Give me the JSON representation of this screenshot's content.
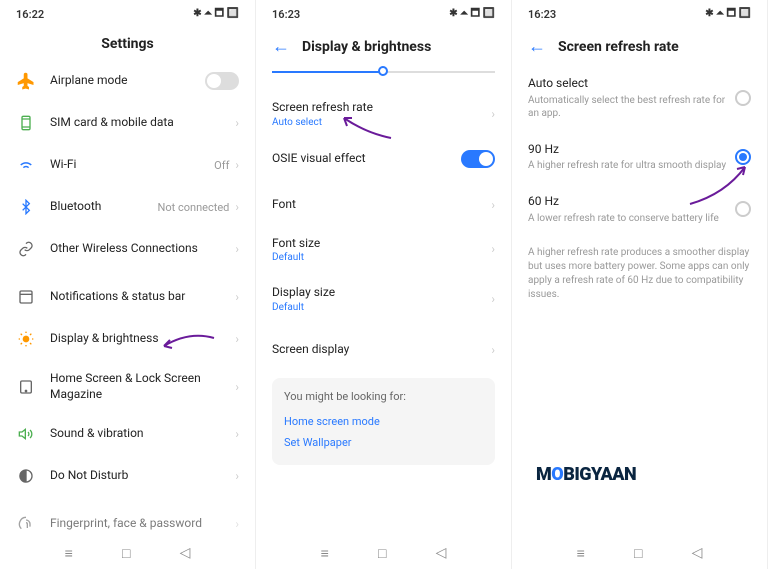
{
  "status": {
    "time1": "16:22",
    "time2": "16:23",
    "time3": "16:23",
    "icons": "✱ ⏶ 🗖 🔲"
  },
  "s1": {
    "title": "Settings",
    "items": {
      "airplane": "Airplane mode",
      "sim": "SIM card & mobile data",
      "wifi": "Wi-Fi",
      "wifi_val": "Off",
      "bt": "Bluetooth",
      "bt_val": "Not connected",
      "owc": "Other Wireless Connections",
      "notif": "Notifications & status bar",
      "display": "Display & brightness",
      "home": "Home Screen & Lock Screen Magazine",
      "sound": "Sound & vibration",
      "dnd": "Do Not Disturb",
      "finger": "Fingerprint, face & password"
    }
  },
  "s2": {
    "title": "Display & brightness",
    "refresh": "Screen refresh rate",
    "refresh_sub": "Auto select",
    "osie": "OSIE visual effect",
    "font": "Font",
    "fontsize": "Font size",
    "fontsize_sub": "Default",
    "dispsize": "Display size",
    "dispsize_sub": "Default",
    "screendisp": "Screen display",
    "suggest_head": "You might be looking for:",
    "suggest1": "Home screen mode",
    "suggest2": "Set Wallpaper"
  },
  "s3": {
    "title": "Screen refresh rate",
    "auto": "Auto select",
    "auto_desc": "Automatically select the best refresh rate for an app.",
    "hz90": "90 Hz",
    "hz90_desc": "A higher refresh rate for ultra smooth display",
    "hz60": "60 Hz",
    "hz60_desc": "A lower refresh rate to conserve battery life",
    "note": "A higher refresh rate produces a smoother display but uses more battery power. Some apps can only apply a refresh rate of 60 Hz due to compatibility issues.",
    "logo_m": "M",
    "logo_o": "O",
    "logo_rest": "BIGYAAN"
  }
}
